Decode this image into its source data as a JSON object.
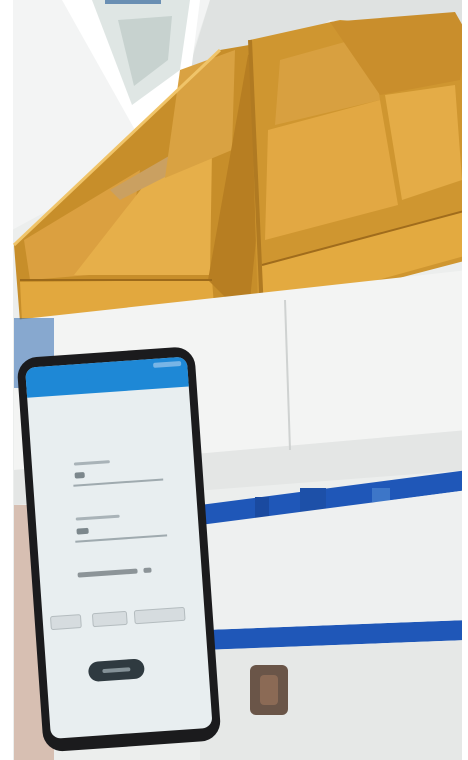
{
  "scene": {
    "description_kind": "photo",
    "colors": {
      "wood": "#d9a43c",
      "wood_dark": "#b07a22",
      "wall": "#eef0ef",
      "table_top": "#f4f5f4",
      "rail_blue": "#1f57b8",
      "phone_body": "#1b1b1d",
      "phone_screen": "#e8eef0",
      "app_bar": "#1e88d6"
    },
    "objects": [
      "window",
      "wooden-drawer-organizer-left",
      "wooden-drawer-organizer-right",
      "white-work-table",
      "blue-table-rails",
      "caster-wheel",
      "smartphone-in-hand"
    ]
  }
}
